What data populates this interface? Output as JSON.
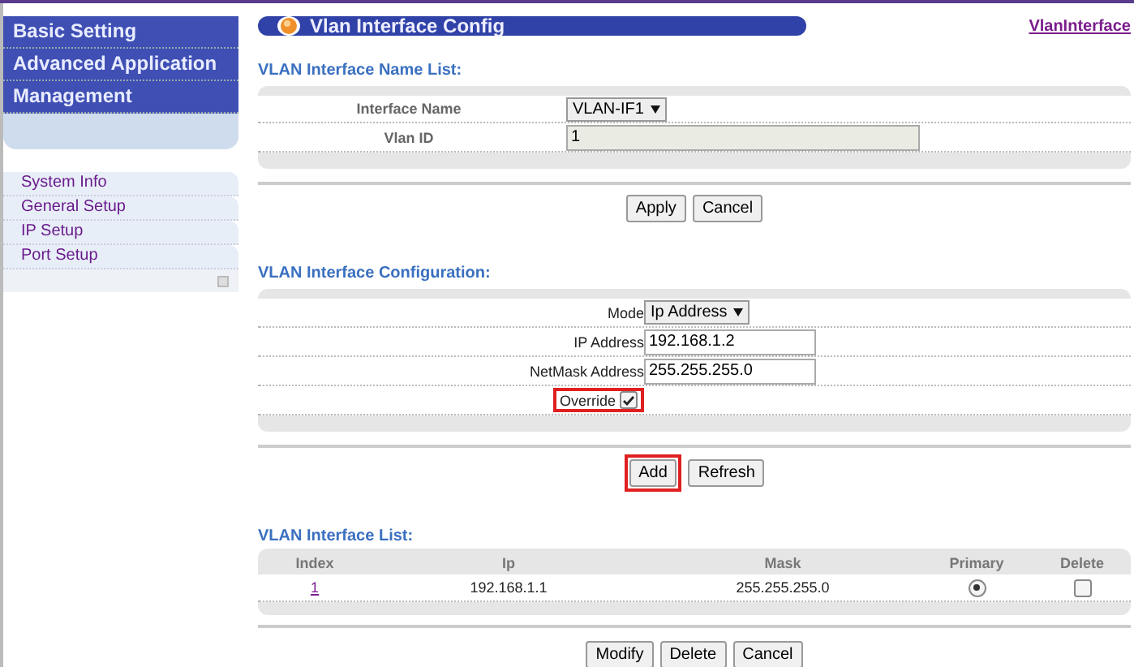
{
  "menu": [
    {
      "label": "Basic Setting"
    },
    {
      "label": "Advanced Application"
    },
    {
      "label": "Management"
    }
  ],
  "submenu": [
    {
      "label": "System Info"
    },
    {
      "label": "General Setup"
    },
    {
      "label": "IP Setup"
    },
    {
      "label": "Port Setup"
    }
  ],
  "title": "Vlan Interface Config",
  "top_link": "VlanInterface",
  "name_list": {
    "heading": "VLAN Interface Name List:",
    "interface_label": "Interface Name",
    "interface_value": "VLAN-IF1",
    "vlan_label": "Vlan ID",
    "vlan_value": "1",
    "buttons": [
      {
        "label": "Apply",
        "highlighted": false
      },
      {
        "label": "Cancel",
        "highlighted": false
      }
    ]
  },
  "config": {
    "heading": "VLAN Interface Configuration:",
    "mode_label": "Mode",
    "mode_value": "Ip Address",
    "ip_label": "IP Address",
    "ip_value": "192.168.1.2",
    "mask_label": "NetMask Address",
    "mask_value": "255.255.255.0",
    "override_label": "Override",
    "override_checked": true,
    "override_highlighted": true,
    "buttons": [
      {
        "label": "Add",
        "highlighted": true
      },
      {
        "label": "Refresh",
        "highlighted": false
      }
    ]
  },
  "list": {
    "heading": "VLAN Interface List:",
    "columns": [
      "Index",
      "Ip",
      "Mask",
      "Primary",
      "Delete"
    ],
    "rows": [
      {
        "index": "1",
        "ip": "192.168.1.1",
        "mask": "255.255.255.0",
        "primary": true,
        "delete": false
      }
    ],
    "buttons": [
      {
        "label": "Modify",
        "highlighted": false
      },
      {
        "label": "Delete",
        "highlighted": false
      },
      {
        "label": "Cancel",
        "highlighted": false
      }
    ]
  }
}
